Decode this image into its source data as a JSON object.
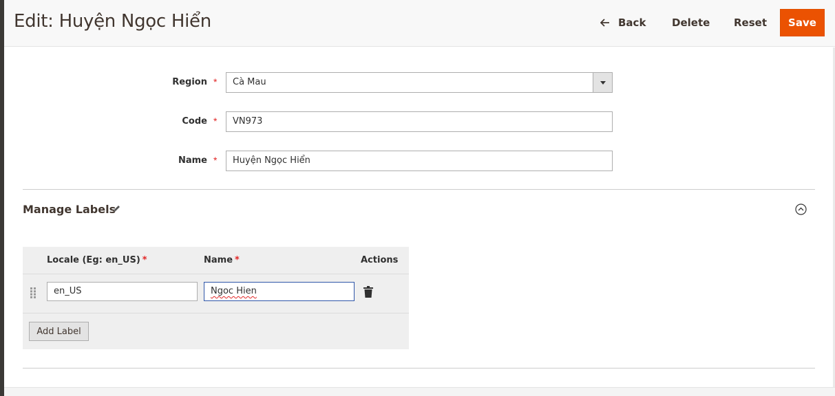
{
  "header": {
    "title": "Edit: Huyện Ngọc Hiển",
    "back_label": "Back",
    "delete_label": "Delete",
    "reset_label": "Reset",
    "save_label": "Save"
  },
  "form": {
    "region": {
      "label": "Region",
      "value": "Cà Mau"
    },
    "code": {
      "label": "Code",
      "value": "VN973"
    },
    "name": {
      "label": "Name",
      "value": "Huyện Ngọc Hiển"
    },
    "required_mark": "*"
  },
  "labels_section": {
    "title": "Manage Labels",
    "columns": {
      "locale": "Locale (Eg: en_US)",
      "name": "Name",
      "actions": "Actions"
    },
    "rows": [
      {
        "locale": "en_US",
        "name": "Ngoc Hien"
      }
    ],
    "add_label": "Add Label"
  },
  "colors": {
    "accent": "#eb5202",
    "required": "#e22626",
    "focus_border": "#2d55a8"
  },
  "icons": {
    "back": "arrow-left-icon",
    "select": "caret-down-icon",
    "edit": "pencil-icon",
    "collapse": "chevron-up-circle-icon",
    "drag": "drag-handle-icon",
    "delete": "trash-icon"
  }
}
